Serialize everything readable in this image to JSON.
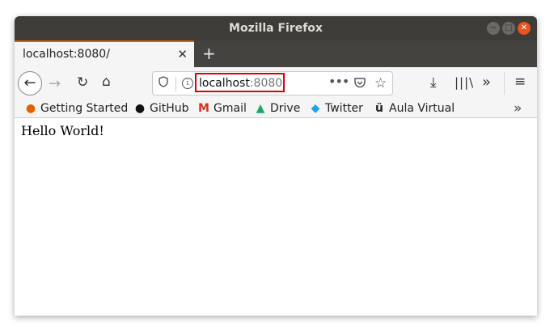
{
  "window": {
    "title": "Mozilla Firefox",
    "buttons": {
      "minimize": "−",
      "maximize": "□",
      "close": "✕"
    }
  },
  "tabs": [
    {
      "label": "localhost:8080/",
      "active": true
    }
  ],
  "tab_close": "✕",
  "new_tab": "+",
  "nav": {
    "back": "←",
    "forward": "→",
    "reload": "↻",
    "home": "⌂",
    "download": "⤓",
    "library": "|||\\",
    "overflow": "»",
    "menu": "≡"
  },
  "urlbar": {
    "host": "localhost",
    "port": ":8080",
    "highlight_color": "#e00000",
    "more": "•••",
    "pocket": "◡",
    "star": "☆"
  },
  "bookmarks": [
    {
      "label": "Getting Started",
      "icon": "firefox-icon",
      "glyph": "●",
      "color": "#e66000"
    },
    {
      "label": "GitHub",
      "icon": "github-icon",
      "glyph": "●",
      "color": "#111111"
    },
    {
      "label": "Gmail",
      "icon": "gmail-icon",
      "glyph": "M",
      "color": "#d93025"
    },
    {
      "label": "Drive",
      "icon": "drive-icon",
      "glyph": "▲",
      "color": "#1fa463"
    },
    {
      "label": "Twitter",
      "icon": "twitter-icon",
      "glyph": "◆",
      "color": "#1da1f2"
    },
    {
      "label": "Aula Virtual",
      "icon": "aula-virtual-icon",
      "glyph": "ü",
      "color": "#222222"
    }
  ],
  "bookmarks_more": "»",
  "page": {
    "text": "Hello World!"
  }
}
